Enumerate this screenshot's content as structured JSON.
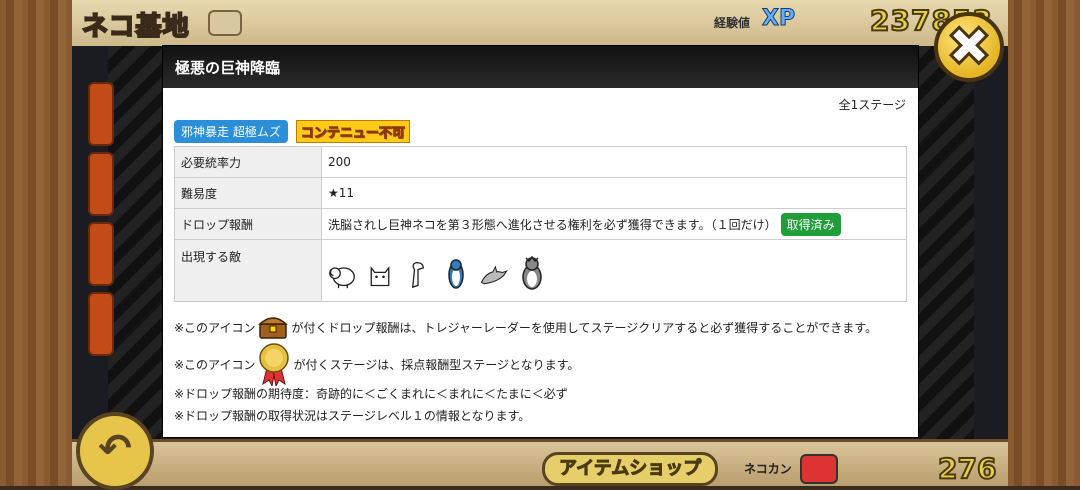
{
  "background": {
    "title": "ネコ基地",
    "xp_label": "経験値",
    "xp_badge": "XP",
    "xp_value": "237853",
    "shop_label": "アイテムショップ",
    "catfood_label": "ネコカン",
    "catfood_value": "276"
  },
  "dialog": {
    "title": "極悪の巨神降臨",
    "stage_count": "全1ステージ",
    "tag": "邪神暴走 超極ムズ",
    "no_continue": "コンテニュー不可",
    "rows": {
      "energy_label": "必要統率力",
      "energy_value": "200",
      "difficulty_label": "難易度",
      "difficulty_value": "★11",
      "reward_label": "ドロップ報酬",
      "reward_value": "洗脳されし巨神ネコを第３形態へ進化させる権利を必ず獲得できます。（１回だけ）",
      "reward_status": "取得済み",
      "enemies_label": "出現する敵"
    },
    "enemies": [
      "sheep-enemy",
      "cat-enemy",
      "bird-enemy",
      "penguin-enemy",
      "dolphin-enemy",
      "emperor-penguin-enemy"
    ],
    "notes": {
      "n1_pre": "※このアイコン",
      "n1_post": "が付くドロップ報酬は、トレジャーレーダーを使用してステージクリアすると必ず獲得することができます。",
      "n2_pre": "※このアイコン",
      "n2_post": "が付くステージは、採点報酬型ステージとなります。",
      "n3": "※ドロップ報酬の期待度：奇跡的に＜ごくまれに＜まれに＜たまに＜必ず",
      "n4": "※ドロップ報酬の取得状況はステージレベル１の情報となります。"
    }
  },
  "colors": {
    "tag_blue": "#2a8fd8",
    "badge_green": "#1f9e3a",
    "close_gold": "#e5b522"
  }
}
